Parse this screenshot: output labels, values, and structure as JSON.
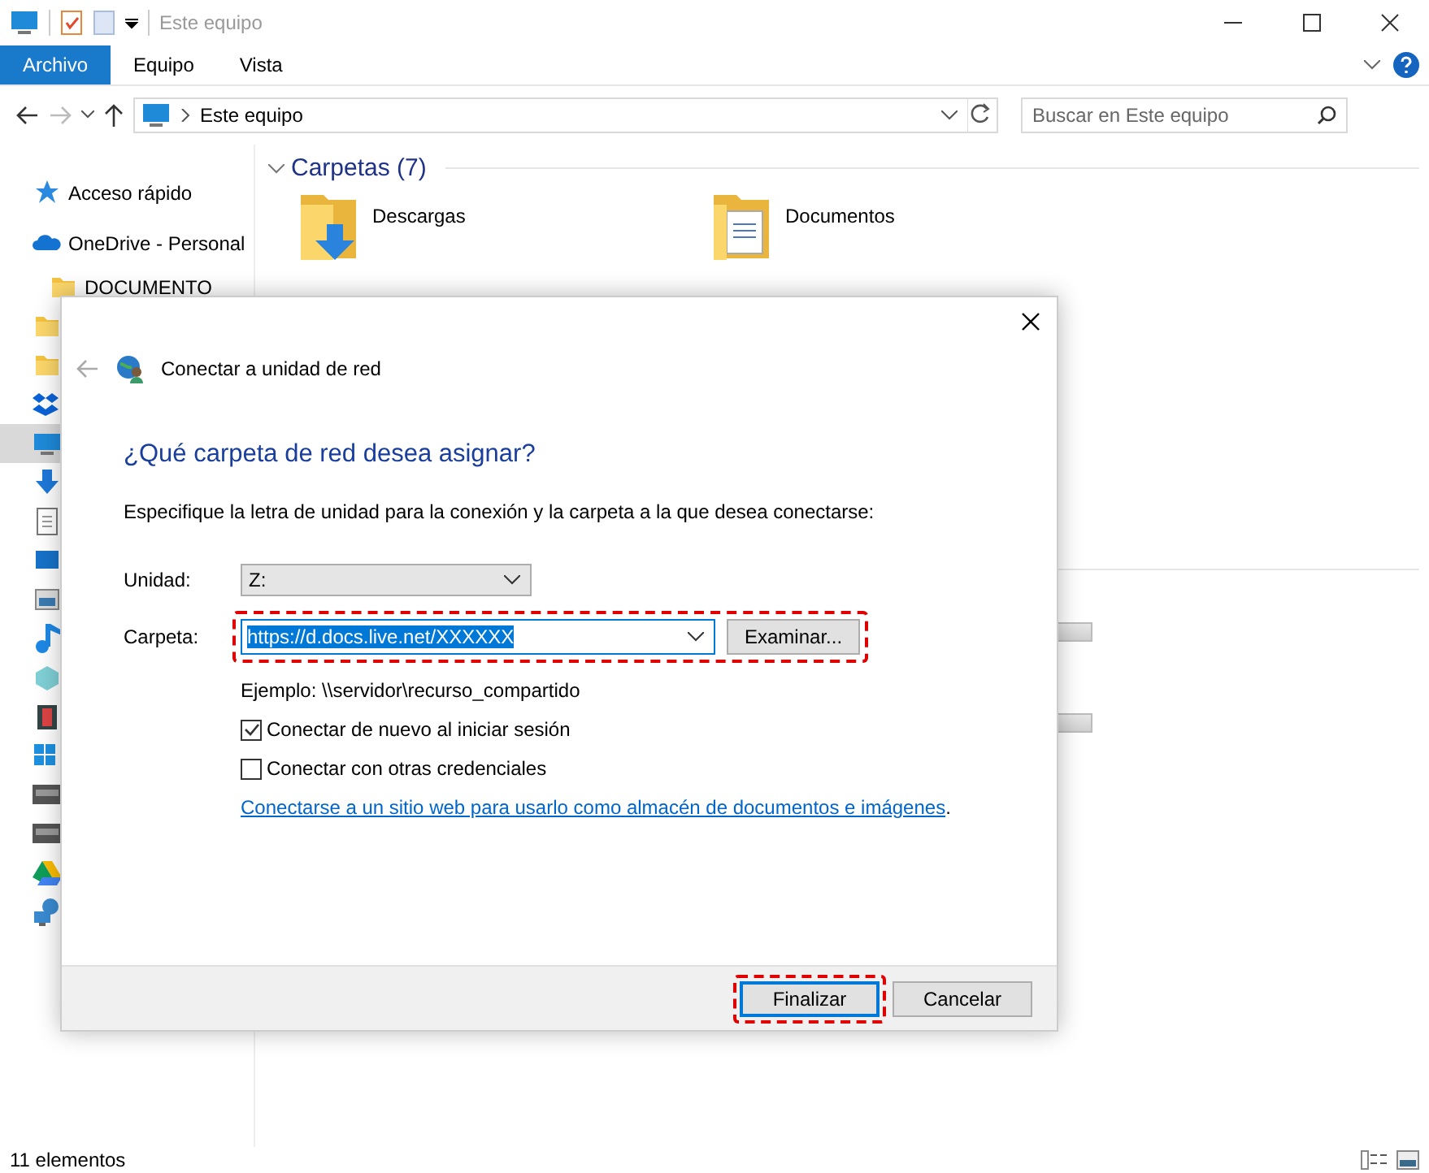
{
  "explorer": {
    "title": "Este equipo",
    "ribbon_tabs": [
      {
        "label": "Archivo",
        "selected": true
      },
      {
        "label": "Equipo",
        "selected": false
      },
      {
        "label": "Vista",
        "selected": false
      }
    ],
    "address": {
      "path": "Este equipo"
    },
    "search": {
      "placeholder": "Buscar en Este equipo"
    },
    "nav_items": [
      {
        "label": "Acceso rápido",
        "kind": "star"
      },
      {
        "label": "OneDrive - Personal",
        "kind": "cloud",
        "children": [
          {
            "label": "DOCUMENTO",
            "kind": "folder"
          }
        ]
      }
    ],
    "nav_hidden": [
      {
        "kind": "folder",
        "selected": false
      },
      {
        "kind": "folder",
        "selected": false
      },
      {
        "kind": "dropbox",
        "selected": false
      },
      {
        "kind": "pc",
        "selected": true
      },
      {
        "kind": "download",
        "selected": false
      },
      {
        "kind": "document",
        "selected": false
      },
      {
        "kind": "desktop",
        "selected": false
      },
      {
        "kind": "picture",
        "selected": false
      },
      {
        "kind": "music",
        "selected": false
      },
      {
        "kind": "cube",
        "selected": false
      },
      {
        "kind": "video",
        "selected": false
      },
      {
        "kind": "windows",
        "selected": false
      },
      {
        "kind": "drive",
        "selected": false
      },
      {
        "kind": "drive",
        "selected": false
      },
      {
        "kind": "gdrive",
        "selected": false
      },
      {
        "kind": "network",
        "selected": false
      }
    ],
    "content": {
      "group": "Carpetas (7)",
      "folders": [
        {
          "name": "Descargas",
          "kind": "downloads"
        },
        {
          "name": "Documentos",
          "kind": "documents"
        }
      ]
    },
    "status_bar": "11 elementos"
  },
  "dialog": {
    "title": "Conectar a unidad de red",
    "heading": "¿Qué carpeta de red desea asignar?",
    "instruction": "Especifique la letra de unidad para la conexión y la carpeta a la que desea conectarse:",
    "fields": [
      {
        "label": "Unidad:",
        "value": "Z:",
        "kind": "dropdown",
        "highlighted": false
      },
      {
        "label": "Carpeta:",
        "value": "https://d.docs.live.net/XXXXXX",
        "kind": "combo",
        "highlighted": true
      }
    ],
    "browse_button": "Examinar...",
    "example": "Ejemplo: \\\\servidor\\recurso_compartido",
    "options": [
      {
        "label": "Conectar de nuevo al iniciar sesión",
        "checked": true
      },
      {
        "label": "Conectar con otras credenciales",
        "checked": false
      }
    ],
    "link": {
      "text": "Conectarse a un sitio web para usarlo como almacén de documentos e imágenes",
      "after": "."
    },
    "buttons": [
      {
        "label": "Finalizar",
        "default": true,
        "highlighted": true
      },
      {
        "label": "Cancelar",
        "default": false,
        "highlighted": false
      }
    ]
  }
}
